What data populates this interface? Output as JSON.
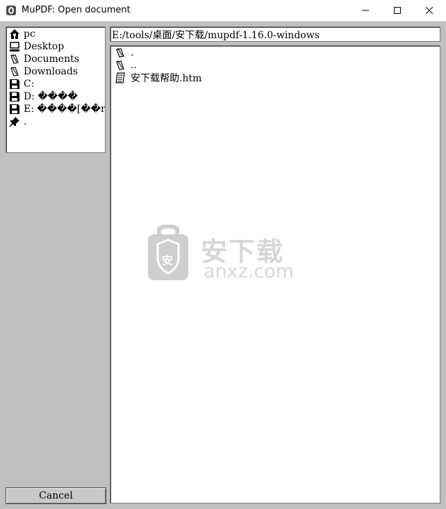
{
  "window": {
    "title": "MuPDF: Open document"
  },
  "places": [
    {
      "label": "pc",
      "icon": "home-icon"
    },
    {
      "label": "Desktop",
      "icon": "computer-icon"
    },
    {
      "label": "Documents",
      "icon": "folder-icon"
    },
    {
      "label": "Downloads",
      "icon": "folder-icon"
    },
    {
      "label": "C:",
      "icon": "disk-icon"
    },
    {
      "label": "D: ����",
      "icon": "disk-icon"
    },
    {
      "label": "E: ����[��r",
      "icon": "disk-icon"
    },
    {
      "label": ".",
      "icon": "pin-icon"
    }
  ],
  "path": "E:/tools/桌面/安下载/mupdf-1.16.0-windows",
  "files": [
    {
      "name": ".",
      "icon": "folder-icon"
    },
    {
      "name": "..",
      "icon": "folder-icon"
    },
    {
      "name": "安下载帮助.htm",
      "icon": "document-icon"
    }
  ],
  "cancel_label": "Cancel",
  "watermark": {
    "cn": "安下载",
    "en": "anxz.com",
    "badge": "安"
  }
}
